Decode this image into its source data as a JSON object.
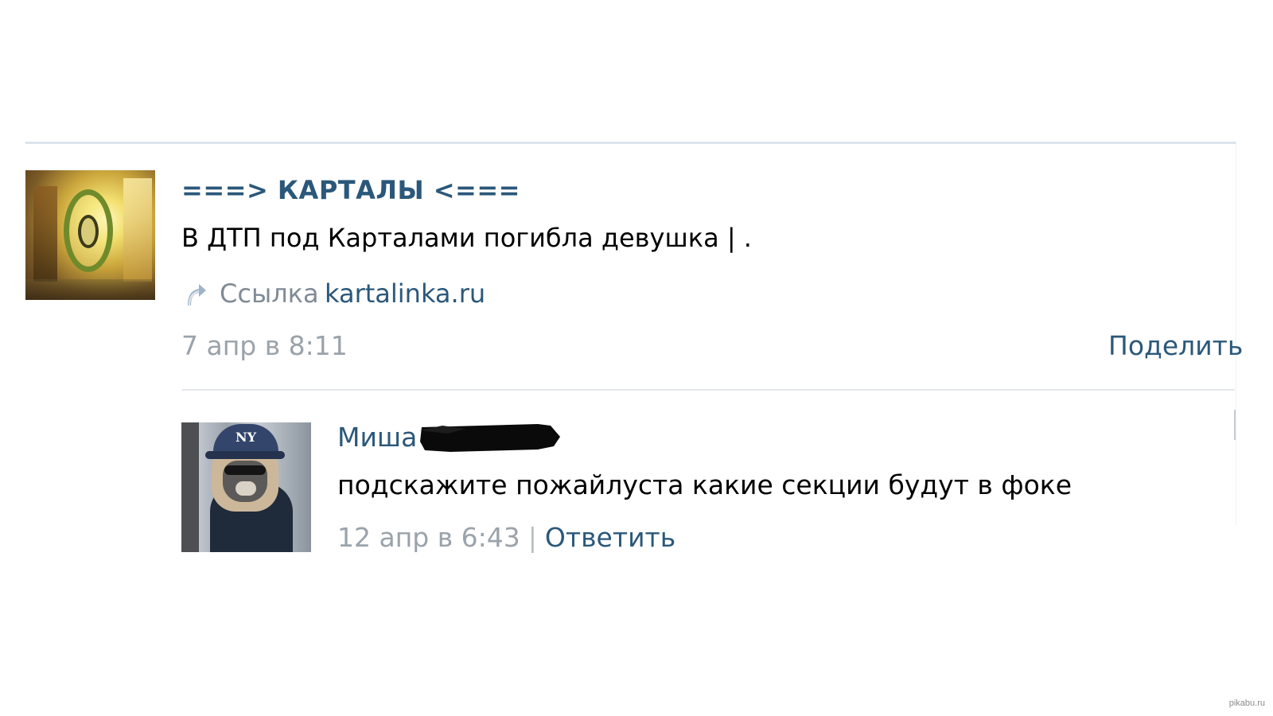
{
  "post": {
    "group_name": "===> КАРТАЛЫ <===",
    "text": "В ДТП под Карталами погибла девушка | .",
    "link": {
      "prefix": "Ссылка",
      "domain": "kartalinka.ru",
      "icon": "arrow-link-icon"
    },
    "date": "7 апр в 8:11",
    "share_label": "Поделить"
  },
  "comment": {
    "author": "Миша",
    "author_surname_redacted": true,
    "text": "подскажите пожайлуста какие секции будут в фоке",
    "date": "12 апр в 6:43",
    "separator": "|",
    "reply_label": "Ответить"
  },
  "watermark": "pikabu.ru",
  "colors": {
    "link": "#2b587a",
    "muted": "#9aa3ab",
    "text": "#000000",
    "divider": "#dde4ec"
  }
}
